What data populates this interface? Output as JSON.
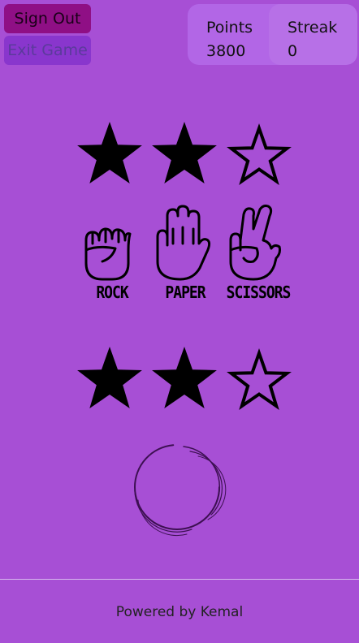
{
  "header": {
    "sign_out_label": "Sign Out",
    "exit_game_label": "Exit Game"
  },
  "score": {
    "points_label": "Points",
    "points_value": "3800",
    "streak_label": "Streak",
    "streak_value": "0"
  },
  "opponent_lives": {
    "filled": 2,
    "total": 3
  },
  "player_lives": {
    "filled": 2,
    "total": 3
  },
  "choices": [
    {
      "label": "ROCK",
      "icon": "fist-icon"
    },
    {
      "label": "PAPER",
      "icon": "open-hand-icon"
    },
    {
      "label": "SCISSORS",
      "icon": "peace-hand-icon"
    }
  ],
  "status": {
    "icon": "loading-spinner-icon"
  },
  "footer": {
    "text": "Powered by Kemal"
  },
  "colors": {
    "background": "#a74fd5",
    "sign_out_button": "#8f0f85",
    "exit_button": "#8936cd",
    "score_panel": "#b266e6"
  }
}
